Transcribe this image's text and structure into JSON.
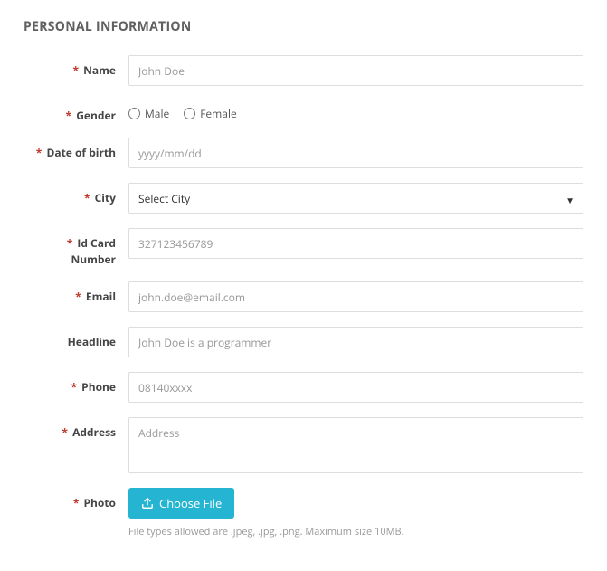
{
  "section_title": "PERSONAL INFORMATION",
  "labels": {
    "name": "Name",
    "gender": "Gender",
    "dob": "Date of birth",
    "city": "City",
    "idcard": "Id Card Number",
    "email": "Email",
    "headline": "Headline",
    "phone": "Phone",
    "address": "Address",
    "photo": "Photo"
  },
  "placeholders": {
    "name": "John Doe",
    "dob": "yyyy/mm/dd",
    "idcard": "327123456789",
    "email": "john.doe@email.com",
    "headline": "John Doe is a programmer",
    "phone": "08140xxxx",
    "address": "Address"
  },
  "gender_options": {
    "male": "Male",
    "female": "Female"
  },
  "city": {
    "selected": "Select City"
  },
  "photo": {
    "button": "Choose File",
    "hint": "File types allowed are .jpeg, .jpg, .png. Maximum size 10MB."
  },
  "required_marker": "*"
}
